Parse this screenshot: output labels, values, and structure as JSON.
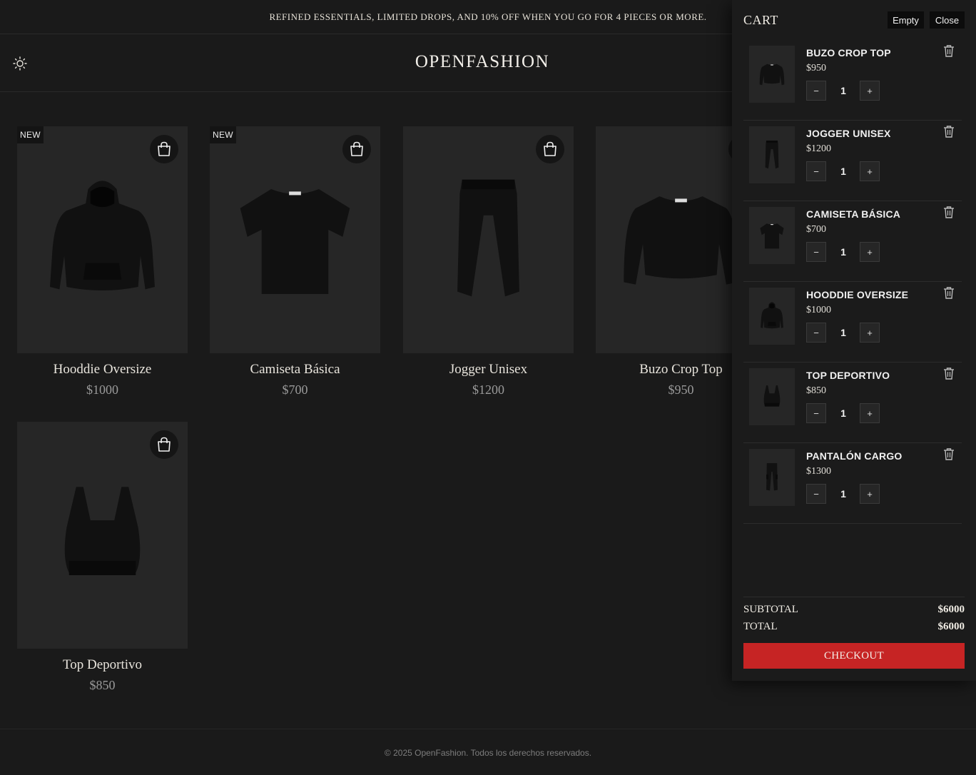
{
  "announcement": "REFINED ESSENTIALS, LIMITED DROPS, AND 10% OFF WHEN YOU GO FOR 4 PIECES OR MORE.",
  "brand": "OPENFASHION",
  "theme_icon": "sun-icon",
  "products": [
    {
      "name": "Hooddie Oversize",
      "price": "$1000",
      "badge": "NEW",
      "garment": "hoodie"
    },
    {
      "name": "Camiseta Básica",
      "price": "$700",
      "badge": "NEW",
      "garment": "tshirt"
    },
    {
      "name": "Jogger Unisex",
      "price": "$1200",
      "badge": "",
      "garment": "jogger"
    },
    {
      "name": "Buzo Crop Top",
      "price": "$950",
      "badge": "",
      "garment": "sweater"
    },
    {
      "name": "Top Deportivo",
      "price": "$850",
      "badge": "",
      "garment": "bra"
    }
  ],
  "cart": {
    "title": "CART",
    "empty_label": "Empty",
    "close_label": "Close",
    "items": [
      {
        "name": "BUZO CROP TOP",
        "price": "$950",
        "qty": "1",
        "garment": "sweater"
      },
      {
        "name": "JOGGER UNISEX",
        "price": "$1200",
        "qty": "1",
        "garment": "jogger"
      },
      {
        "name": "CAMISETA BÁSICA",
        "price": "$700",
        "qty": "1",
        "garment": "tshirt"
      },
      {
        "name": "HOODDIE OVERSIZE",
        "price": "$1000",
        "qty": "1",
        "garment": "hoodie"
      },
      {
        "name": "TOP DEPORTIVO",
        "price": "$850",
        "qty": "1",
        "garment": "bra"
      },
      {
        "name": "PANTALÓN CARGO",
        "price": "$1300",
        "qty": "1",
        "garment": "cargo"
      }
    ],
    "minus": "−",
    "plus": "+",
    "subtotal_label": "SUBTOTAL",
    "subtotal_value": "$6000",
    "total_label": "TOTAL",
    "total_value": "$6000",
    "checkout_label": "CHECKOUT"
  },
  "footer": "© 2025 OpenFashion. Todos los derechos reservados.",
  "colors": {
    "background": "#1a1a1a",
    "card": "#262626",
    "accent": "#c62424"
  }
}
